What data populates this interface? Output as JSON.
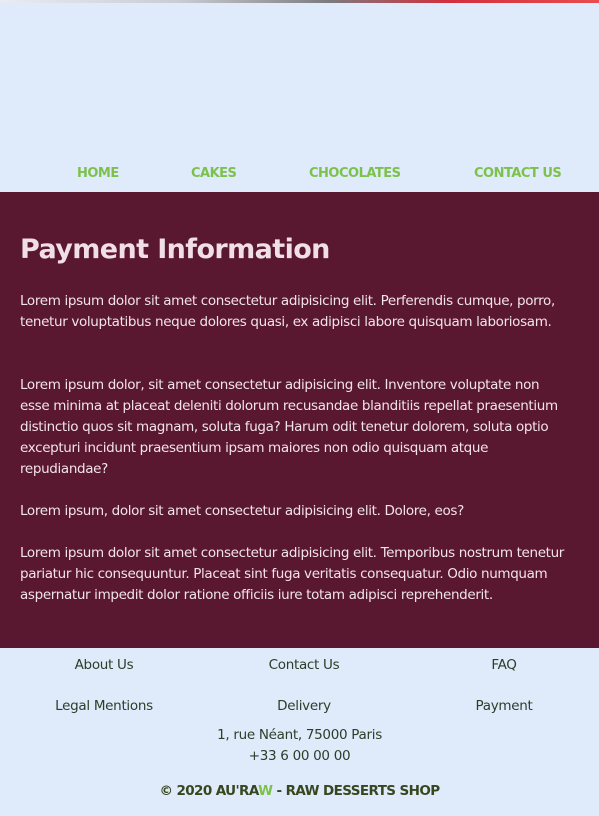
{
  "nav": {
    "items": [
      {
        "label": "HOME"
      },
      {
        "label": "CAKES"
      },
      {
        "label": "CHOCOLATES"
      },
      {
        "label": "CONTACT US"
      }
    ]
  },
  "main": {
    "title": "Payment Information",
    "paragraphs": [
      "Lorem ipsum dolor sit amet consectetur adipisicing elit. Perferendis cumque, porro, tenetur voluptatibus neque dolores quasi, ex adipisci labore quisquam laboriosam.",
      "Lorem ipsum dolor, sit amet consectetur adipisicing elit. Inventore voluptate non esse minima at placeat deleniti dolorum recusandae blanditiis repellat praesentium distinctio quos sit magnam, soluta fuga? Harum odit tenetur dolorem, soluta optio excepturi incidunt praesentium ipsam maiores non odio quisquam atque repudiandae?",
      "Lorem ipsum, dolor sit amet consectetur adipisicing elit. Dolore, eos?",
      "Lorem ipsum dolor sit amet consectetur adipisicing elit. Temporibus nostrum tenetur pariatur hic consequuntur. Placeat sint fuga veritatis consequatur. Odio numquam aspernatur impedit dolor ratione officiis iure totam adipisci reprehenderit."
    ]
  },
  "footer": {
    "links": [
      {
        "label": "About Us"
      },
      {
        "label": "Contact Us"
      },
      {
        "label": "FAQ"
      },
      {
        "label": "Legal Mentions"
      },
      {
        "label": "Delivery"
      },
      {
        "label": "Payment"
      }
    ],
    "address": "1, rue Néant, 75000 Paris",
    "phone": "+33 6 00 00 00",
    "copyright_prefix": "© 2020 AU'RA",
    "copyright_brand_accent": "W",
    "copyright_suffix": " - RAW DESSERTS SHOP"
  },
  "colors": {
    "accent": "#7cc24a",
    "main_bg": "#5a1730",
    "page_bg": "#dfeafa"
  }
}
